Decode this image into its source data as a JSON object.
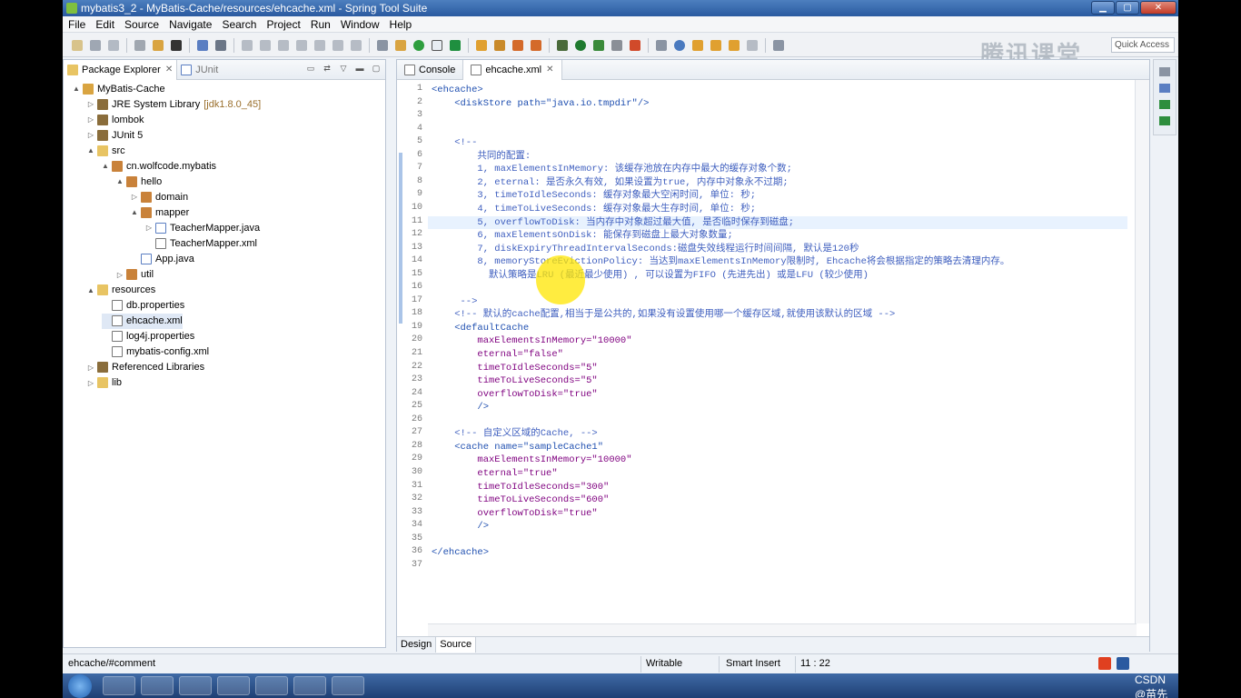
{
  "window": {
    "title": "mybatis3_2 - MyBatis-Cache/resources/ehcache.xml - Spring Tool Suite"
  },
  "menu": [
    "File",
    "Edit",
    "Source",
    "Navigate",
    "Search",
    "Project",
    "Run",
    "Window",
    "Help"
  ],
  "quick_access": "Quick Access",
  "watermark_logo": "腾讯课堂",
  "left_panel": {
    "tabs": [
      {
        "label": "Package Explorer"
      },
      {
        "label": "JUnit"
      }
    ],
    "tree": [
      {
        "label": "MyBatis-Cache",
        "icon": "project"
      },
      {
        "label": "JRE System Library",
        "extra": "[jdk1.8.0_45]",
        "icon": "lib"
      },
      {
        "label": "lombok",
        "icon": "lib"
      },
      {
        "label": "JUnit 5",
        "icon": "lib"
      },
      {
        "label": "src",
        "icon": "folder"
      },
      {
        "label": "cn.wolfcode.mybatis",
        "icon": "pkg"
      },
      {
        "label": "hello",
        "icon": "pkg"
      },
      {
        "label": "domain",
        "icon": "pkg"
      },
      {
        "label": "mapper",
        "icon": "pkg"
      },
      {
        "label": "TeacherMapper.java",
        "icon": "java"
      },
      {
        "label": "TeacherMapper.xml",
        "icon": "file"
      },
      {
        "label": "App.java",
        "icon": "java"
      },
      {
        "label": "util",
        "icon": "pkg"
      },
      {
        "label": "resources",
        "icon": "folder"
      },
      {
        "label": "db.properties",
        "icon": "file"
      },
      {
        "label": "ehcache.xml",
        "icon": "file"
      },
      {
        "label": "log4j.properties",
        "icon": "file"
      },
      {
        "label": "mybatis-config.xml",
        "icon": "file"
      },
      {
        "label": "Referenced Libraries",
        "icon": "lib"
      },
      {
        "label": "lib",
        "icon": "folder"
      }
    ]
  },
  "editor": {
    "tabs": [
      {
        "label": "Console"
      },
      {
        "label": "ehcache.xml"
      }
    ],
    "lines": [
      {
        "n": "1",
        "text": "<ehcache>"
      },
      {
        "n": "2",
        "text": "    <diskStore path=\"java.io.tmpdir\"/>"
      },
      {
        "n": "3",
        "text": ""
      },
      {
        "n": "4",
        "text": ""
      },
      {
        "n": "5",
        "text": "    <!--"
      },
      {
        "n": "6",
        "text": "        共同的配置:"
      },
      {
        "n": "7",
        "text": "        1, maxElementsInMemory: 该缓存池放在内存中最大的缓存对象个数;"
      },
      {
        "n": "8",
        "text": "        2, eternal: 是否永久有效, 如果设置为true, 内存中对象永不过期;"
      },
      {
        "n": "9",
        "text": "        3, timeToIdleSeconds: 缓存对象最大空闲时间, 单位: 秒;"
      },
      {
        "n": "10",
        "text": "        4, timeToLiveSeconds: 缓存对象最大生存时间, 单位: 秒;"
      },
      {
        "n": "11",
        "text": "        5, overflowToDisk: 当内存中对象超过最大值, 是否临时保存到磁盘;"
      },
      {
        "n": "12",
        "text": "        6, maxElementsOnDisk: 能保存到磁盘上最大对象数量;"
      },
      {
        "n": "13",
        "text": "        7, diskExpiryThreadIntervalSeconds:磁盘失效线程运行时间间隔, 默认是120秒"
      },
      {
        "n": "14",
        "text": "        8, memoryStoreEvictionPolicy: 当达到maxElementsInMemory限制时, Ehcache将会根据指定的策略去清理内存。"
      },
      {
        "n": "15",
        "text": "          默认策略是LRU (最近最少使用) , 可以设置为FIFO (先进先出) 或是LFU (较少使用)"
      },
      {
        "n": "16",
        "text": ""
      },
      {
        "n": "17",
        "text": "     -->"
      },
      {
        "n": "18",
        "text": "    <!-- 默认的cache配置,相当于是公共的,如果没有设置使用哪一个缓存区域,就使用该默认的区域 -->"
      },
      {
        "n": "19",
        "text": "    <defaultCache"
      },
      {
        "n": "20",
        "text": "        maxElementsInMemory=\"10000\""
      },
      {
        "n": "21",
        "text": "        eternal=\"false\""
      },
      {
        "n": "22",
        "text": "        timeToIdleSeconds=\"5\""
      },
      {
        "n": "23",
        "text": "        timeToLiveSeconds=\"5\""
      },
      {
        "n": "24",
        "text": "        overflowToDisk=\"true\""
      },
      {
        "n": "25",
        "text": "        />"
      },
      {
        "n": "26",
        "text": ""
      },
      {
        "n": "27",
        "text": "    <!-- 自定义区域的Cache, -->"
      },
      {
        "n": "28",
        "text": "    <cache name=\"sampleCache1\""
      },
      {
        "n": "29",
        "text": "        maxElementsInMemory=\"10000\""
      },
      {
        "n": "30",
        "text": "        eternal=\"true\""
      },
      {
        "n": "31",
        "text": "        timeToIdleSeconds=\"300\""
      },
      {
        "n": "32",
        "text": "        timeToLiveSeconds=\"600\""
      },
      {
        "n": "33",
        "text": "        overflowToDisk=\"true\""
      },
      {
        "n": "34",
        "text": "        />"
      },
      {
        "n": "35",
        "text": ""
      },
      {
        "n": "36",
        "text": "</ehcache>"
      },
      {
        "n": "37",
        "text": ""
      }
    ],
    "bottom_tabs": [
      {
        "label": "Design"
      },
      {
        "label": "Source"
      }
    ]
  },
  "status": {
    "path": "ehcache/#comment",
    "writable": "Writable",
    "insert": "Smart Insert",
    "position": "11 : 22"
  },
  "taskbar": {
    "watermark": "CSDN @苗先森"
  }
}
